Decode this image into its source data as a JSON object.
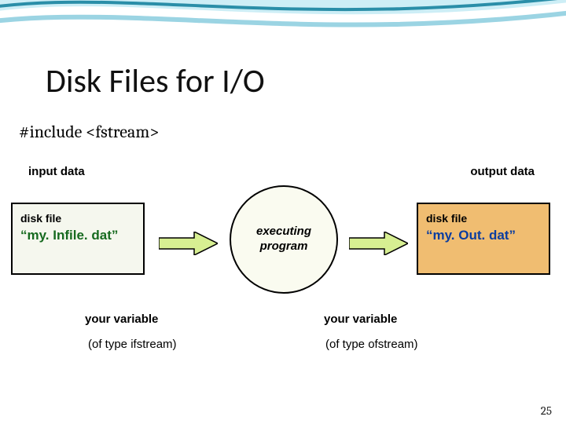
{
  "title": "Disk Files for I/O",
  "include_line": "#include <fstream>",
  "labels": {
    "input_data": "input data",
    "output_data": "output data"
  },
  "left_box": {
    "k": "disk file",
    "fn": "“my. Infile. dat”"
  },
  "right_box": {
    "k": "disk file",
    "fn": "“my. Out. dat”"
  },
  "center": {
    "line1": "executing",
    "line2": "program"
  },
  "captions": {
    "var1": "your variable",
    "var2": "your variable",
    "type1": "(of type ifstream)",
    "type2": "(of type ofstream)"
  },
  "page": "25",
  "colors": {
    "swoosh_a": "#2a8ea8",
    "swoosh_b": "#9bd4e3",
    "arrow_fill": "#d7ef92",
    "arrow_stroke": "#000000"
  }
}
